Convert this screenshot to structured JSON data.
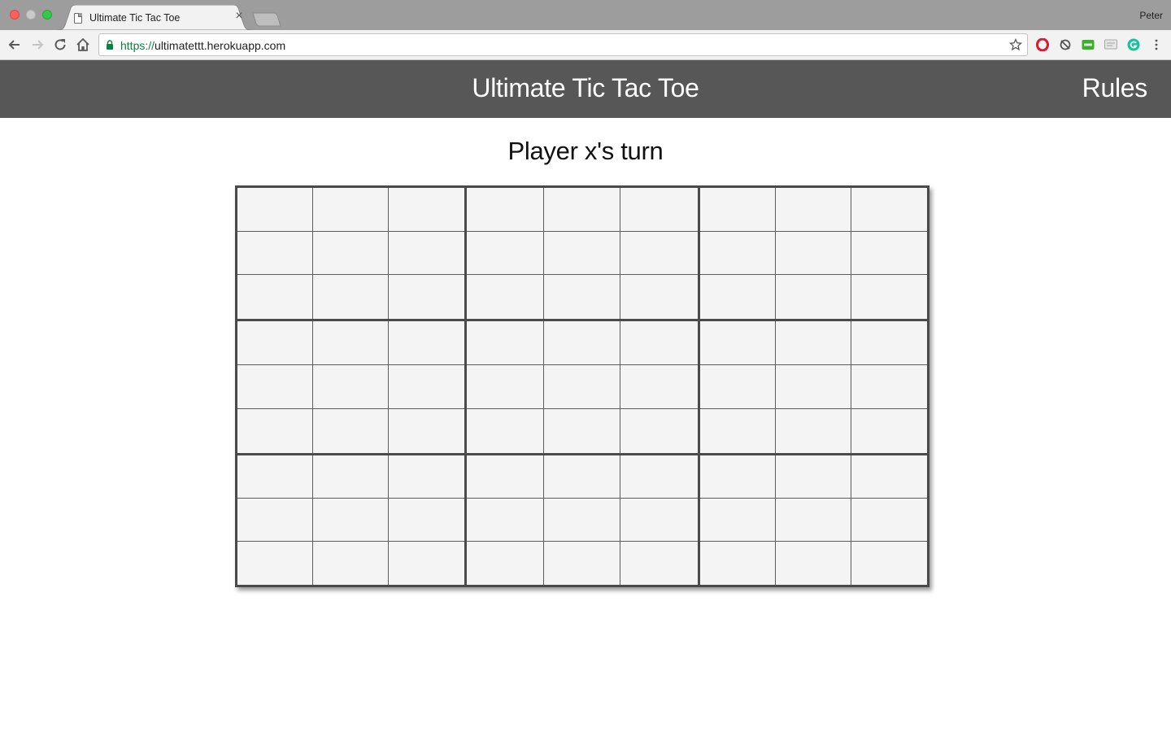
{
  "browser": {
    "tab_title": "Ultimate Tic Tac Toe",
    "tab_close": "×",
    "url_scheme": "https://",
    "url_host": "ultimatettt.herokuapp.com",
    "profile_name": "Peter"
  },
  "site": {
    "title": "Ultimate Tic Tac Toe",
    "rules_label": "Rules"
  },
  "game": {
    "status": "Player x's turn",
    "boards": [
      [
        "",
        "",
        "",
        "",
        "",
        "",
        "",
        "",
        ""
      ],
      [
        "",
        "",
        "",
        "",
        "",
        "",
        "",
        "",
        ""
      ],
      [
        "",
        "",
        "",
        "",
        "",
        "",
        "",
        "",
        ""
      ],
      [
        "",
        "",
        "",
        "",
        "",
        "",
        "",
        "",
        ""
      ],
      [
        "",
        "",
        "",
        "",
        "",
        "",
        "",
        "",
        ""
      ],
      [
        "",
        "",
        "",
        "",
        "",
        "",
        "",
        "",
        ""
      ],
      [
        "",
        "",
        "",
        "",
        "",
        "",
        "",
        "",
        ""
      ],
      [
        "",
        "",
        "",
        "",
        "",
        "",
        "",
        "",
        ""
      ],
      [
        "",
        "",
        "",
        "",
        "",
        "",
        "",
        "",
        ""
      ]
    ]
  },
  "colors": {
    "header_bg": "#575757",
    "cell_bg": "#f4f4f4",
    "grid_line": "#4a4a4a"
  }
}
